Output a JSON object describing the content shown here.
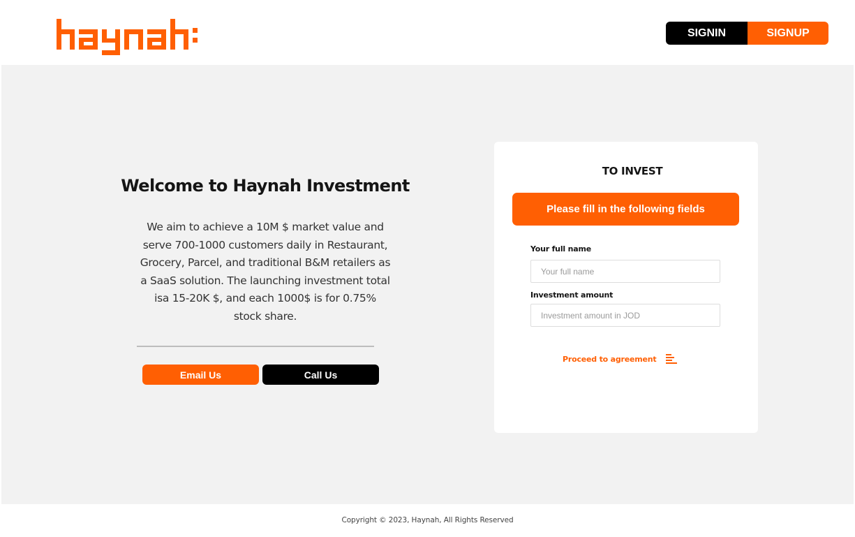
{
  "header": {
    "logo_text": "haynah:",
    "signin_label": "SIGNIN",
    "signup_label": "SIGNUP"
  },
  "welcome": {
    "title": "Welcome to Haynah Investment",
    "description": "We aim to achieve a 10M $ market value and serve 700-1000 customers daily in Restaurant, Grocery, Parcel, and traditional B&M retailers as a SaaS solution. The launching investment total isa 15-20K $, and each 1000$ is for 0.75% stock share.",
    "email_label": "Email Us",
    "call_label": "Call Us"
  },
  "invest_form": {
    "title": "TO INVEST",
    "banner": "Please fill in the following fields",
    "name_label": "Your full name",
    "name_placeholder": "Your full name",
    "name_value": "",
    "amount_label": "Investment amount",
    "amount_placeholder": "Investment amount in JOD",
    "amount_value": "",
    "proceed_label": "Proceed to agreement",
    "proceed_icon": "menu-lines-icon"
  },
  "footer": {
    "copyright": "Copyright © 2023, Haynah, All Rights Reserved"
  },
  "colors": {
    "brand_orange": "#ff5f03",
    "black": "#000000",
    "main_background": "#f2f2f2",
    "card_background": "#ffffff"
  }
}
